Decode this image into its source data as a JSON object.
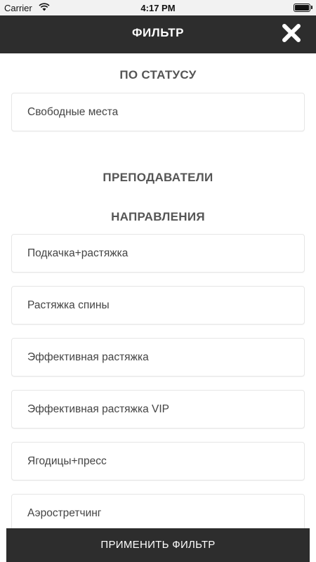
{
  "status_bar": {
    "carrier": "Carrier",
    "time": "4:17 PM",
    "wifi_icon": "wifi-icon",
    "battery_icon": "battery-icon"
  },
  "header": {
    "title": "ФИЛЬТР",
    "close_icon": "close-icon",
    "background": "#2d2d2d"
  },
  "sections": {
    "status": {
      "title": "ПО СТАТУСУ",
      "items": [
        "Свободные места"
      ]
    },
    "teachers": {
      "title": "ПРЕПОДАВАТЕЛИ"
    },
    "directions": {
      "title": "НАПРАВЛЕНИЯ",
      "items": [
        "Подкачка+растяжка",
        "Растяжка спины",
        "Эффективная растяжка",
        "Эффективная растяжка VIP",
        "Ягодицы+пресс",
        "Аэростретчинг"
      ]
    }
  },
  "footer": {
    "apply_label": "ПРИМЕНИТЬ ФИЛЬТР"
  }
}
